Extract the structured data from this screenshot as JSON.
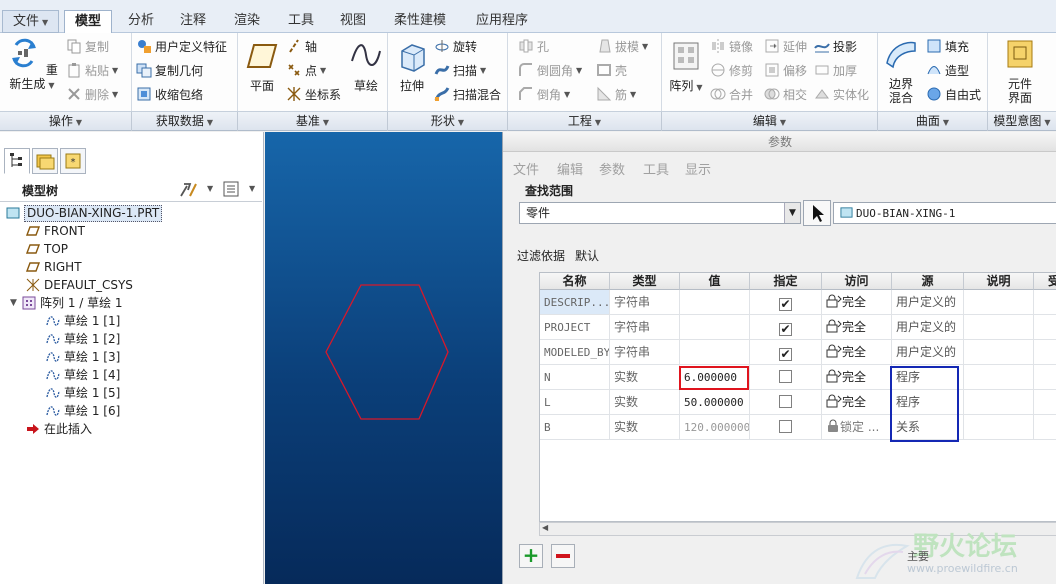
{
  "tabs": {
    "file": "文件",
    "model": "模型",
    "analysis": "分析",
    "annotate": "注释",
    "render": "渲染",
    "tools": "工具",
    "view": "视图",
    "flexible": "柔性建模",
    "applications": "应用程序"
  },
  "ribbon": {
    "regenerate": "重新生成",
    "copy": "复制",
    "paste": "粘贴",
    "delete": "删除",
    "user_defined_feature": "用户定义特征",
    "copy_geometry": "复制几何",
    "shrinkwrap": "收缩包络",
    "plane": "平面",
    "axis": "轴",
    "point": "点",
    "csys": "坐标系",
    "sketch": "草绘",
    "extrude": "拉伸",
    "revolve": "旋转",
    "sweep": "扫描",
    "swept_blend": "扫描混合",
    "hole": "孔",
    "round": "倒圆角",
    "chamfer": "倒角",
    "draft": "拔模",
    "shell": "壳",
    "rib": "筋",
    "pattern": "阵列",
    "mirror": "镜像",
    "extend": "延伸",
    "project": "投影",
    "trim": "修剪",
    "offset": "偏移",
    "thicken": "加厚",
    "merge": "合并",
    "intersect": "相交",
    "solidify": "实体化",
    "boundary_blend_line1": "边界",
    "boundary_blend_line2": "混合",
    "fill": "填充",
    "style": "造型",
    "freestyle": "自由式",
    "component_interface_line1": "元件",
    "component_interface_line2": "界面"
  },
  "groups": {
    "operations": "操作",
    "get_data": "获取数据",
    "datum": "基准",
    "shapes": "形状",
    "engineering": "工程",
    "editing": "编辑",
    "surfaces": "曲面",
    "model_intent": "模型意图"
  },
  "tree": {
    "title": "模型树",
    "root": "DUO-BIAN-XING-1.PRT",
    "front": "FRONT",
    "top": "TOP",
    "right": "RIGHT",
    "csys": "DEFAULT_CSYS",
    "pattern": "阵列 1 / 草绘 1",
    "sketches": [
      "草绘 1 [1]",
      "草绘 1 [2]",
      "草绘 1 [3]",
      "草绘 1 [4]",
      "草绘 1 [5]",
      "草绘 1 [6]"
    ],
    "insert_here": "在此插入"
  },
  "params": {
    "title": "参数",
    "menu": [
      "文件",
      "编辑",
      "参数",
      "工具",
      "显示"
    ],
    "scope_label": "查找范围",
    "scope_value": "零件",
    "scope_model": "DUO-BIAN-XING-1",
    "filter_label": "过滤依据",
    "filter_value": "默认",
    "columns": [
      "名称",
      "类型",
      "值",
      "指定",
      "访问",
      "源",
      "说明",
      "受"
    ],
    "rows": [
      {
        "name": "DESCRIP...",
        "type": "字符串",
        "value": "",
        "designated": true,
        "access": "完全",
        "source": "用户定义的"
      },
      {
        "name": "PROJECT",
        "type": "字符串",
        "value": "",
        "designated": true,
        "access": "完全",
        "source": "用户定义的"
      },
      {
        "name": "MODELED_BY",
        "type": "字符串",
        "value": "",
        "designated": true,
        "access": "完全",
        "source": "用户定义的"
      },
      {
        "name": "N",
        "type": "实数",
        "value": "6.000000",
        "designated": false,
        "access": "完全",
        "source": "程序"
      },
      {
        "name": "L",
        "type": "实数",
        "value": "50.000000",
        "designated": false,
        "access": "完全",
        "source": "程序"
      },
      {
        "name": "B",
        "type": "实数",
        "value": "120.000000",
        "designated": false,
        "access": "锁定 ...",
        "source": "关系"
      }
    ]
  },
  "watermark": {
    "title": "野火论坛",
    "sub": "主要",
    "url": "www.proewildfire.cn"
  },
  "colors": {
    "highlight_red": "#e0141e",
    "highlight_blue": "#1428b4",
    "hexagon": "#d8182a"
  }
}
